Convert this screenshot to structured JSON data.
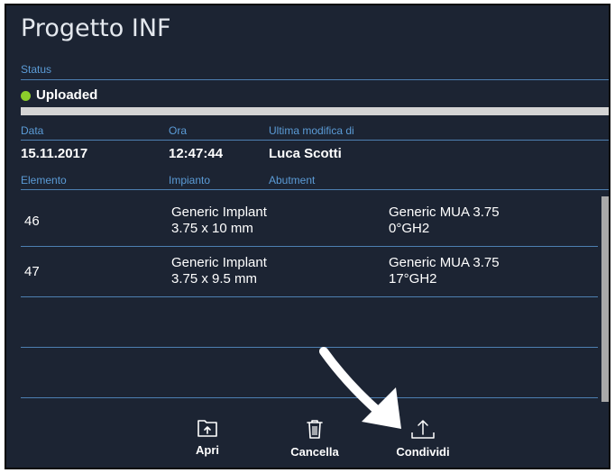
{
  "title": "Progetto INF",
  "status": {
    "label": "Status",
    "value": "Uploaded",
    "dot_color": "#8ccf2b",
    "progress": 1.0
  },
  "meta": {
    "headers": [
      "Data",
      "Ora",
      "Ultima modifica di"
    ],
    "values": [
      "15.11.2017",
      "12:47:44",
      "Luca Scotti"
    ]
  },
  "table": {
    "headers": [
      "Elemento",
      "Impianto",
      "Abutment"
    ],
    "rows": [
      {
        "element": "46",
        "implant_1": "Generic Implant",
        "implant_2": "3.75 x 10 mm",
        "abutment_1": "Generic MUA 3.75",
        "abutment_2": "0°GH2"
      },
      {
        "element": "47",
        "implant_1": "Generic Implant",
        "implant_2": "3.75 x 9.5 mm",
        "abutment_1": "Generic MUA 3.75",
        "abutment_2": "17°GH2"
      },
      {
        "element": "",
        "implant_1": "",
        "implant_2": "",
        "abutment_1": "",
        "abutment_2": ""
      },
      {
        "element": "",
        "implant_1": "",
        "implant_2": "",
        "abutment_1": "",
        "abutment_2": ""
      }
    ]
  },
  "actions": [
    {
      "label": "Apri",
      "icon": "folder-upload-icon"
    },
    {
      "label": "Cancella",
      "icon": "trash-icon"
    },
    {
      "label": "Condividi",
      "icon": "share-upload-icon"
    }
  ],
  "colors": {
    "background": "#1c2433",
    "accent": "#5b9bd6",
    "divider": "#4d7fb1"
  }
}
